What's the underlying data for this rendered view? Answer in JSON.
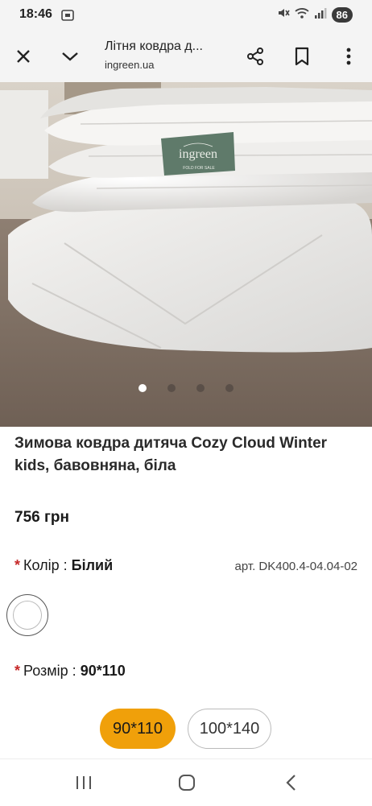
{
  "status_bar": {
    "time": "18:46",
    "battery": "86",
    "icons": [
      "screenshot-icon",
      "mute-icon",
      "wifi-icon",
      "signal-icon"
    ]
  },
  "toolbar": {
    "page_title": "Літня ковдра д...",
    "url": "ingreen.ua",
    "icons": [
      "close-icon",
      "chevron-down-icon",
      "share-icon",
      "bookmark-icon",
      "more-icon"
    ]
  },
  "gallery": {
    "label_brand": "ingreen",
    "label_tagline": "FOLD FOR SALE",
    "total_slides": 4,
    "active_slide": 1
  },
  "product": {
    "title": "Зимова ковдра дитяча Cozy Cloud Winter kids, бавовняна, біла",
    "price": "756 грн"
  },
  "color_option": {
    "required_mark": "*",
    "label": "Колір :",
    "value": "Білий",
    "sku": "арт. DK400.4-04.04-02",
    "swatch_color": "#ffffff"
  },
  "size_option": {
    "required_mark": "*",
    "label": "Розмір :",
    "value": "90*110",
    "options": [
      "90*110",
      "100*140"
    ],
    "selected_color": "#f0a00a"
  },
  "colors": {
    "accent": "#f0a00a",
    "required": "#c62828"
  },
  "nav_bar": {
    "icons": [
      "recents-icon",
      "home-icon",
      "back-icon"
    ]
  }
}
